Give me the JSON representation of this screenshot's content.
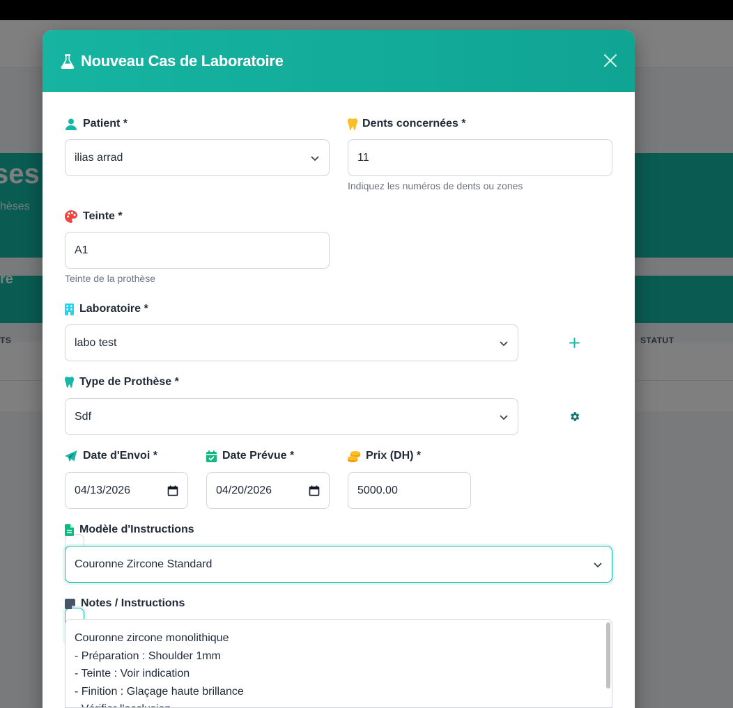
{
  "background": {
    "hero_title": "ses",
    "hero_subtitle": "hèses",
    "bar_text": "re",
    "table_headers": [
      "TS",
      "STATUT"
    ]
  },
  "modal": {
    "title": "Nouveau Cas de Laboratoire",
    "patient": {
      "label": "Patient *",
      "value": "ilias arrad"
    },
    "dents": {
      "label": "Dents concernées *",
      "value": "11",
      "help": "Indiquez les numéros de dents ou zones"
    },
    "teinte": {
      "label": "Teinte *",
      "value": "A1",
      "help": "Teinte de la prothèse"
    },
    "laboratoire": {
      "label": "Laboratoire *",
      "value": "labo test"
    },
    "type_prothese": {
      "label": "Type de Prothèse *",
      "value": "Sdf"
    },
    "date_envoi": {
      "label": "Date d'Envoi *",
      "value": "04/13/2026"
    },
    "date_prevue": {
      "label": "Date Prévue *",
      "value": "04/20/2026"
    },
    "prix": {
      "label": "Prix (DH) *",
      "value": "5000.00"
    },
    "modele": {
      "label": "Modèle d'Instructions",
      "value": "Couronne Zircone Standard"
    },
    "notes": {
      "label": "Notes / Instructions",
      "lines": [
        "Couronne zircone monolithique",
        "- Préparation : Shoulder 1mm",
        "- Teinte : Voir indication",
        "- Finition : Glaçage haute brillance",
        "- Vérifier l'occlusion"
      ]
    }
  },
  "colors": {
    "accent": "#14b8a6",
    "dark_accent": "#0f766e",
    "icon_yellow": "#fbbf24",
    "icon_red": "#ef4444",
    "icon_cyan": "#22d3ee",
    "icon_slate": "#64748b"
  },
  "icons": {
    "title": "flask-icon",
    "close": "close-icon",
    "patient": "user-icon",
    "dents": "tooth-icon",
    "teinte": "palette-icon",
    "laboratoire": "building-icon",
    "type": "tooth-icon",
    "date_envoi": "paper-plane-icon",
    "date_prevue": "calendar-check-icon",
    "prix": "coins-icon",
    "modele": "file-icon",
    "notes": "sticky-note-icon",
    "add": "plus-icon",
    "settings": "gear-icon"
  }
}
